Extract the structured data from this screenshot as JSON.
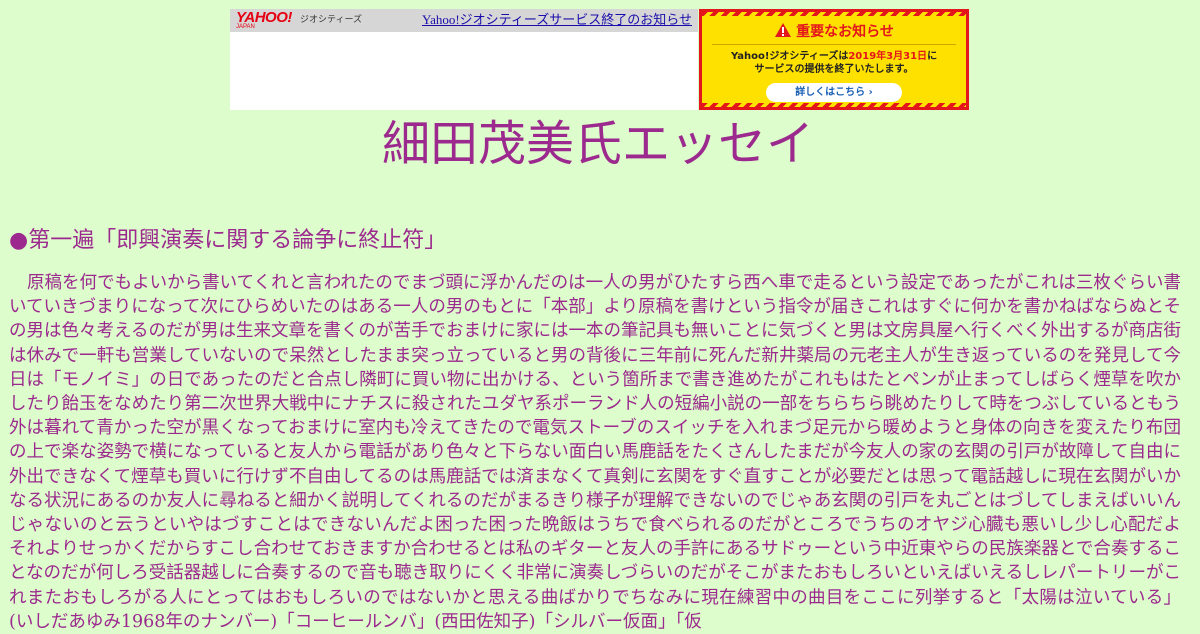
{
  "banner": {
    "logo_text": "YAHOO!",
    "logo_sub": "JAPAN",
    "service_label": "ジオシティーズ",
    "end_notice_link": "Yahoo!ジオシティーズサービス終了のお知らせ",
    "notice": {
      "title": "重要なお知らせ",
      "body_pre": "Yahoo!ジオシティーズは",
      "body_date": "2019年3月31日",
      "body_post_line1": "に",
      "body_line2": "サービスの提供を終了いたします。",
      "button_label": "詳しくはこちら ›",
      "accent_color": "#e3161c",
      "background_color": "#ffe100"
    }
  },
  "page": {
    "title": "細田茂美氏エッセイ",
    "heading": "●第一遍「即興演奏に関する論争に終止符」",
    "body": "原稿を何でもよいから書いてくれと言われたのでまづ頭に浮かんだのは一人の男がひたすら西へ車で走るという設定であったがこれは三枚ぐらい書いていきづまりになって次にひらめいたのはある一人の男のもとに「本部」より原稿を書けという指令が届きこれはすぐに何かを書かねばならぬとその男は色々考えるのだが男は生来文章を書くのが苦手でおまけに家には一本の筆記具も無いことに気づくと男は文房具屋へ行くべく外出するが商店街は休みで一軒も営業していないので呆然としたまま突っ立っていると男の背後に三年前に死んだ新井薬局の元老主人が生き返っているのを発見して今日は「モノイミ」の日であったのだと合点し隣町に買い物に出かける、という箇所まで書き進めたがこれもはたとペンが止まってしばらく煙草を吹かしたり飴玉をなめたり第二次世界大戦中にナチスに殺されたユダヤ系ポーランド人の短編小説の一部をちらちら眺めたりして時をつぶしているともう外は暮れて青かった空が黒くなっておまけに室内も冷えてきたので電気ストーブのスイッチを入れまづ足元から暖めようと身体の向きを変えたり布団の上で楽な姿勢で横になっていると友人から電話があり色々と下らない面白い馬鹿話をたくさんしたまだが今友人の家の玄関の引戸が故障して自由に外出できなくて煙草も買いに行けず不自由してるのは馬鹿話では済まなくて真剣に玄関をすぐ直すことが必要だとは思って電話越しに現在玄関がいかなる状況にあるのか友人に尋ねると細かく説明してくれるのだがまるきり様子が理解できないのでじゃあ玄関の引戸を丸ごとはづしてしまえばいいんじゃないのと云うといやはづすことはできないんだよ困った困った晩飯はうちで食べられるのだがところでうちのオヤジ心臓も悪いし少し心配だよそれよりせっかくだからすこし合わせておきますか合わせるとは私のギターと友人の手許にあるサドゥーという中近東やらの民族楽器とで合奏することなのだが何しろ受話器越しに合奏するので音も聴き取りにくく非常に演奏しづらいのだがそこがまたおもしろいといえばいえるしレパートリーがこれまたおもしろがる人にとってはおもしろいのではないかと思える曲ばかりでちなみに現在練習中の曲目をここに列挙すると「太陽は泣いている」(いしだあゆみ1968年のナンバー)「コーヒールンバ」(西田佐知子)「シルバー仮面」「仮",
    "text_color": "#9c2a8e",
    "background_color": "#ddfdcc"
  }
}
